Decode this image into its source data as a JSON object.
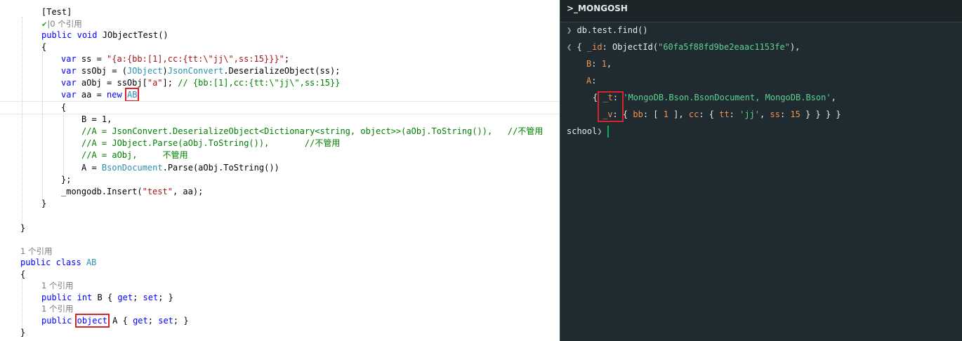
{
  "editor": {
    "attr_text": "[Test]",
    "method_lens": "0 个引用",
    "method_sig_public": "public",
    "method_sig_void": "void",
    "method_sig_name": "JObjectTest()",
    "brace_open": "{",
    "brace_close": "}",
    "line_var_ss_kw": "var",
    "line_var_ss_a": " ss = ",
    "line_var_ss_str": "\"{a:{bb:[1],cc:{tt:\\\"jj\\\",ss:15}}}\"",
    "line_var_ss_end": ";",
    "line_ssobj_kw": "var",
    "line_ssobj_a": " ssObj = (",
    "line_ssobj_type": "JObject",
    "line_ssobj_b": ")",
    "line_ssobj_type2": "JsonConvert",
    "line_ssobj_c": ".DeserializeObject(ss);",
    "line_aobj_kw": "var",
    "line_aobj_a": " aObj = ssObj[",
    "line_aobj_str": "\"a\"",
    "line_aobj_b": "]; ",
    "line_aobj_cm": "// {bb:[1],cc:{tt:\\\"jj\\\",ss:15}}",
    "line_aa_kw": "var",
    "line_aa_a": " aa = ",
    "line_aa_new": "new",
    "line_aa_type": "AB",
    "line_init_b": "B = 1,",
    "line_cm1": "//A = JsonConvert.DeserializeObject<Dictionary<string, object>>(aObj.ToString()),   //不管用",
    "line_cm2": "//A = JObject.Parse(aObj.ToString()),       //不管用",
    "line_cm3": "//A = aObj,     不管用",
    "line_a_a": "A = ",
    "line_a_type": "BsonDocument",
    "line_a_b": ".Parse(aObj.ToString())",
    "line_init_end": "};",
    "line_insert_a": "_mongodb.Insert(",
    "line_insert_str": "\"test\"",
    "line_insert_b": ", aa);",
    "class_lens": "1 个引用",
    "class_public": "public",
    "class_kw": "class",
    "class_name": "AB",
    "prop_b_lens": "1 个引用",
    "prop_b_public": "public",
    "prop_b_type": "int",
    "prop_b_rest_a": " B { ",
    "prop_get": "get",
    "prop_mid": "; ",
    "prop_set": "set",
    "prop_end": "; }",
    "prop_a_lens": "1 个引用",
    "prop_a_public": "public",
    "prop_a_type": "object",
    "prop_a_rest_a": " A { "
  },
  "mongosh": {
    "title": ">_MONGOSH",
    "input_cmd": "db.test.find()",
    "out_open": "{ ",
    "out_id_key": "_id",
    "out_id_call": ": ObjectId(",
    "out_id_val": "\"60fa5f88fd9be2eaac1153fe\"",
    "out_id_close": "),",
    "out_b_key": "B",
    "out_b_sep": ": ",
    "out_b_val": "1",
    "out_b_comma": ",",
    "out_a_key": "A",
    "out_a_sep": ":",
    "out_t_brace": "{ ",
    "out_t_key": "_t",
    "out_t_sep": ": ",
    "out_t_val": "'MongoDB.Bson.BsonDocument, MongoDB.Bson'",
    "out_t_comma": ",",
    "out_v_key": "_v",
    "out_v_a": ": { ",
    "out_bb_key": "bb",
    "out_bb_a": ": [ ",
    "out_bb_val": "1",
    "out_bb_b": " ], ",
    "out_cc_key": "cc",
    "out_cc_a": ": { ",
    "out_tt_key": "tt",
    "out_tt_a": ": ",
    "out_tt_val": "'jj'",
    "out_tt_b": ", ",
    "out_ss_key": "ss",
    "out_ss_a": ": ",
    "out_ss_val": "15",
    "out_end": " } } } }",
    "prompt_db": "school",
    "prompt_symbol": "❯",
    "input_symbol": "❯",
    "output_symbol": "❮"
  },
  "colors": {
    "editor_bg": "#ffffff",
    "keyword": "#0000ff",
    "type": "#2b91af",
    "string": "#a31515",
    "comment": "#008000",
    "mongosh_bg": "#1f2b30",
    "mongosh_key": "#f5914d",
    "mongosh_string": "#5fd18d",
    "cursor": "#13aa52",
    "annotation_box": "#d9232a"
  }
}
